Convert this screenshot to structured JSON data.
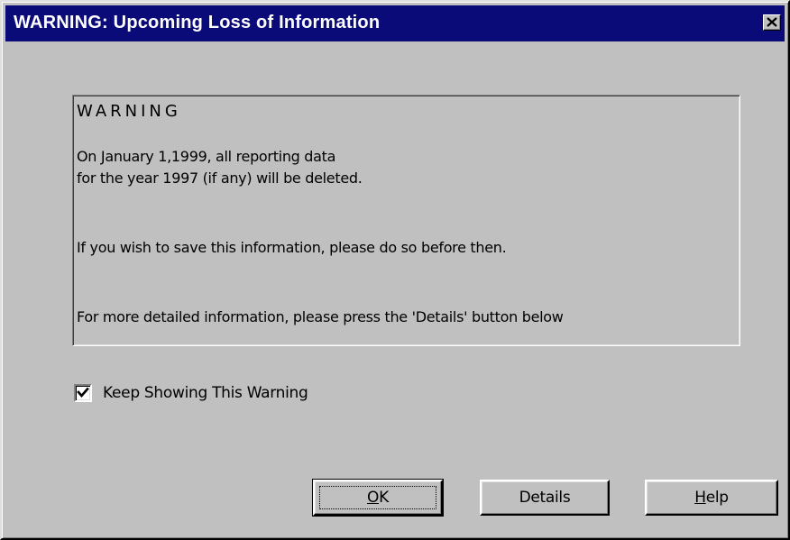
{
  "window": {
    "title": "WARNING: Upcoming Loss of Information",
    "titlebar_color": "#0a0a78",
    "face_color": "#c0c0c0"
  },
  "title_bar": {
    "close_icon": "close-x-icon"
  },
  "message": {
    "heading": "WARNING",
    "line1": "On January 1,1999, all reporting data",
    "line2": "for the year 1997 (if any) will be deleted.",
    "line3": "If you wish to save this information, please do so before then.",
    "line4": "For more detailed information, please  press the 'Details' button below"
  },
  "keep_showing": {
    "label": "Keep Showing This Warning",
    "checked": true,
    "check_icon": "checkmark-icon"
  },
  "buttons": {
    "ok_label": "OK",
    "details_label": "Details",
    "help_label": "Help"
  }
}
